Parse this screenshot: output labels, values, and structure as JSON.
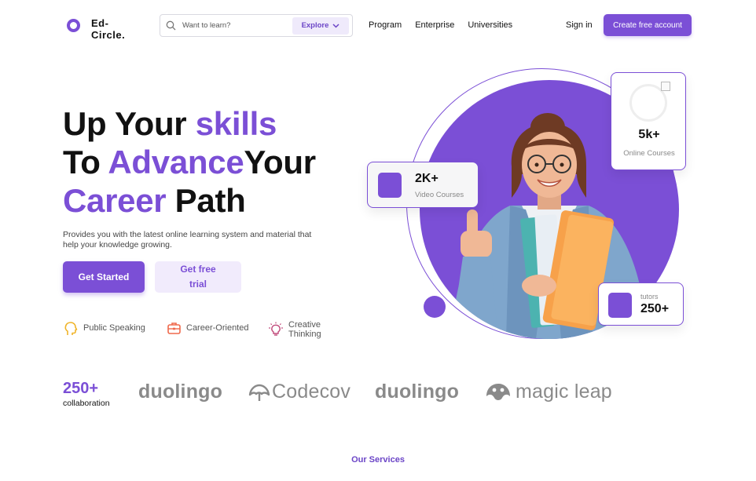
{
  "nav": {
    "logo_text": "Ed-\nCircle.",
    "search_placeholder": "Want to learn?",
    "explore_label": "Explore",
    "links": [
      "Program",
      "Enterprise",
      "Universities"
    ],
    "signin_label": "Sign in",
    "create_account_label": "Create free account"
  },
  "hero": {
    "title_line1_a": "Up Your ",
    "title_line1_b": "skills",
    "title_line2_a": "To ",
    "title_line2_b": "Advance",
    "title_line2_c": "Your",
    "title_line3_a": "Career",
    "title_line3_b": " Path",
    "subtitle": "Provides you with the latest online learning system and material that help your knowledge growing.",
    "get_started_label": "Get Started",
    "free_trial_label": "Get free\ntrial",
    "features": [
      {
        "label": "Public Speaking",
        "icon": "speaking-head-icon"
      },
      {
        "label": "Career-Oriented",
        "icon": "briefcase-icon"
      },
      {
        "label": "Creative\nThinking",
        "icon": "lightbulb-icon"
      }
    ]
  },
  "stats": {
    "videos": {
      "value": "2K+",
      "label": "Video Courses"
    },
    "courses": {
      "value": "5k+",
      "label": "Online Courses"
    },
    "tutors": {
      "value": "250+",
      "label": "tutors"
    }
  },
  "partners": {
    "count": "250+",
    "count_label": "collaboration",
    "logos": [
      "duolingo",
      "Codecov",
      "duolingo",
      "magic leap"
    ]
  },
  "services_heading": "Our Services",
  "colors": {
    "accent": "#7b4fd6",
    "accent_light": "#f1ebfc",
    "partner_gray": "#8a8a8a"
  }
}
